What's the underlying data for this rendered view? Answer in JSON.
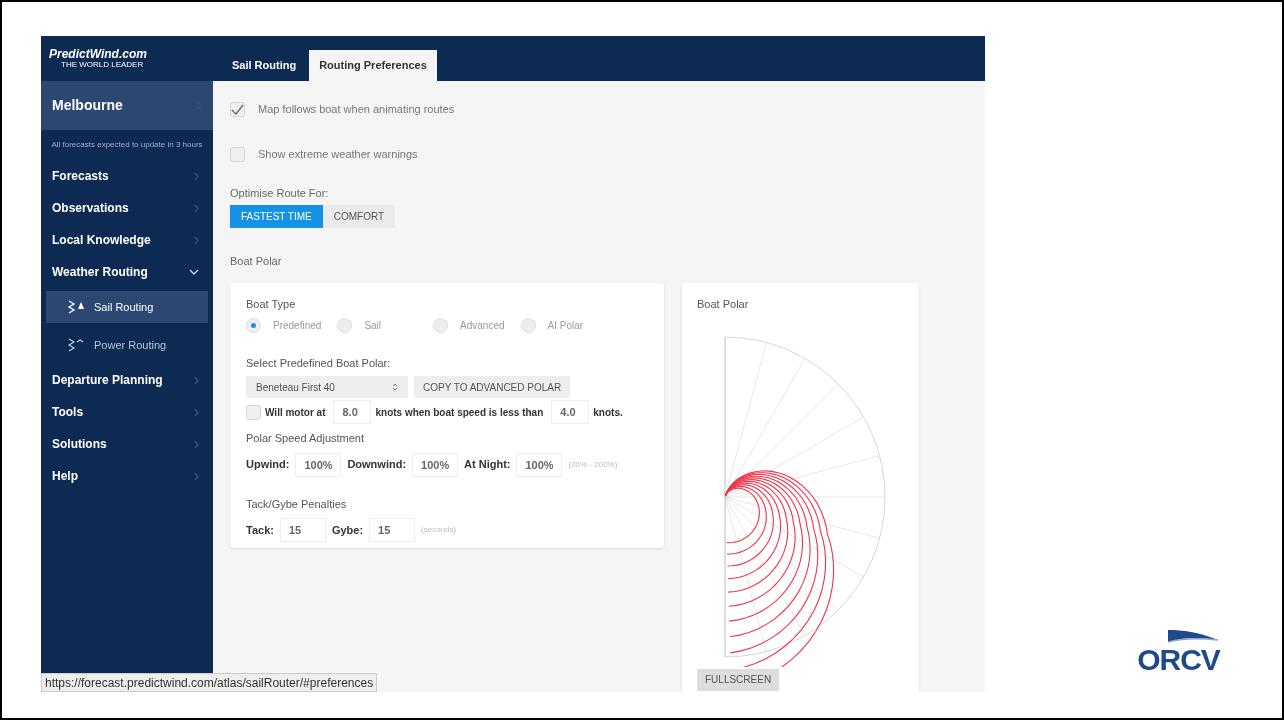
{
  "app_logo": {
    "name": "PredictWind.com",
    "tagline": "THE WORLD LEADER"
  },
  "tabs": [
    {
      "label": "Sail Routing",
      "selected": false
    },
    {
      "label": "Routing Preferences",
      "selected": true
    }
  ],
  "sidebar": {
    "location": "Melbourne",
    "note": "All forecasts expected to update in 3 hours",
    "items": [
      {
        "label": "Forecasts",
        "expanded": false
      },
      {
        "label": "Observations",
        "expanded": false
      },
      {
        "label": "Local Knowledge",
        "expanded": false
      },
      {
        "label": "Weather Routing",
        "expanded": true,
        "children": [
          {
            "label": "Sail Routing",
            "selected": true,
            "kind": "sail"
          },
          {
            "label": "Power Routing",
            "selected": false,
            "kind": "power"
          }
        ]
      },
      {
        "label": "Departure Planning",
        "expanded": false
      },
      {
        "label": "Tools",
        "expanded": false
      },
      {
        "label": "Solutions",
        "expanded": false
      },
      {
        "label": "Help",
        "expanded": false
      }
    ]
  },
  "checkboxes": [
    {
      "label": "Map follows boat when animating routes",
      "checked": true
    },
    {
      "label": "Show extreme weather warnings",
      "checked": false
    }
  ],
  "optimise": {
    "label": "Optimise Route For:",
    "options": [
      {
        "label": "FASTEST TIME",
        "selected": true
      },
      {
        "label": "COMFORT",
        "selected": false
      }
    ]
  },
  "section_title": "Boat Polar",
  "boat_card": {
    "boat_type_label": "Boat Type",
    "boat_types": [
      {
        "label": "Predefined",
        "selected": true
      },
      {
        "label": "Sail",
        "selected": false
      },
      {
        "label": "Advanced",
        "selected": false
      },
      {
        "label": "AI Polar",
        "selected": false
      }
    ],
    "predefined_label": "Select Predefined Boat Polar:",
    "predefined_value": "Beneteau First 40",
    "copy_button": "COPY TO ADVANCED POLAR",
    "motor": {
      "checked": false,
      "text_1": "Will motor at",
      "speed": "8.0",
      "text_2": "knots when boat speed is less than",
      "threshold": "4.0",
      "text_3": "knots."
    },
    "speed_label": "Polar Speed Adjustment",
    "speed_fields": [
      {
        "label": "Upwind:",
        "value": "100%"
      },
      {
        "label": "Downwind:",
        "value": "100%"
      },
      {
        "label": "At Night:",
        "value": "100%"
      }
    ],
    "speed_hint": "(20% - 200%)",
    "penalty_label": "Tack/Gybe Penalties",
    "penalty_fields": [
      {
        "label": "Tack:",
        "value": "15"
      },
      {
        "label": "Gybe:",
        "value": "15"
      }
    ],
    "penalty_hint": "(seconds)"
  },
  "polar_card": {
    "title": "Boat Polar",
    "button": "FULLSCREEN"
  },
  "status_url": "https://forecast.predictwind.com/atlas/sailRouter/#preferences",
  "slide_logo": "ORCV"
}
